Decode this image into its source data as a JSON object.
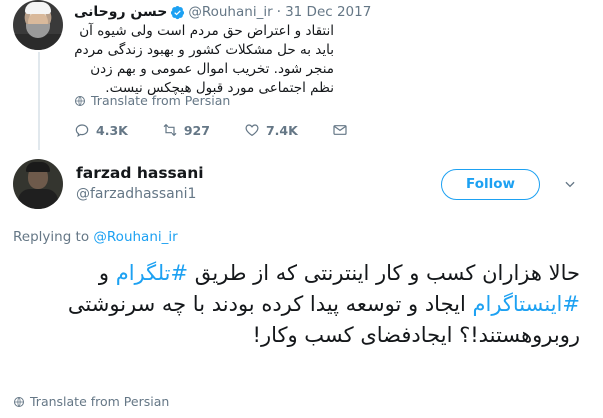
{
  "quoted_tweet": {
    "author_name": "حسن روحانی",
    "handle": "@Rouhani_ir",
    "separator": "·",
    "date": "31 Dec 2017",
    "text": "انتقاد و اعتراض حق مردم است ولی شیوه آن باید به حل مشکلات کشور و بهبود زندگی مردم منجر شود. تخریب اموال عمومی و بهم زدن نظم اجتماعی مورد قبول هیچکس نیست.",
    "translate_label": "Translate from Persian",
    "actions": {
      "replies": "4.3K",
      "retweets": "927",
      "likes": "7.4K"
    }
  },
  "reply_tweet": {
    "author_name": "farzad hassani",
    "handle": "@farzadhassani1",
    "follow_label": "Follow",
    "replying_prefix": "Replying to",
    "replying_to": "@Rouhani_ir",
    "text_part1": "حالا هزاران کسب و کار اینترنتی که از طریق ",
    "hashtag1": "#تلگرام",
    "text_part2": " و ",
    "hashtag2": "#اینستاگرام",
    "text_part3": " ایجاد و توسعه پیدا کرده بودند با چه سرنوشتی روبروهستند!؟ ایجادفضای کسب وکار!",
    "translate_label": "Translate from Persian"
  },
  "colors": {
    "accent": "#1da1f2",
    "muted": "#657786",
    "text": "#14171a",
    "border": "#e1e8ed"
  }
}
